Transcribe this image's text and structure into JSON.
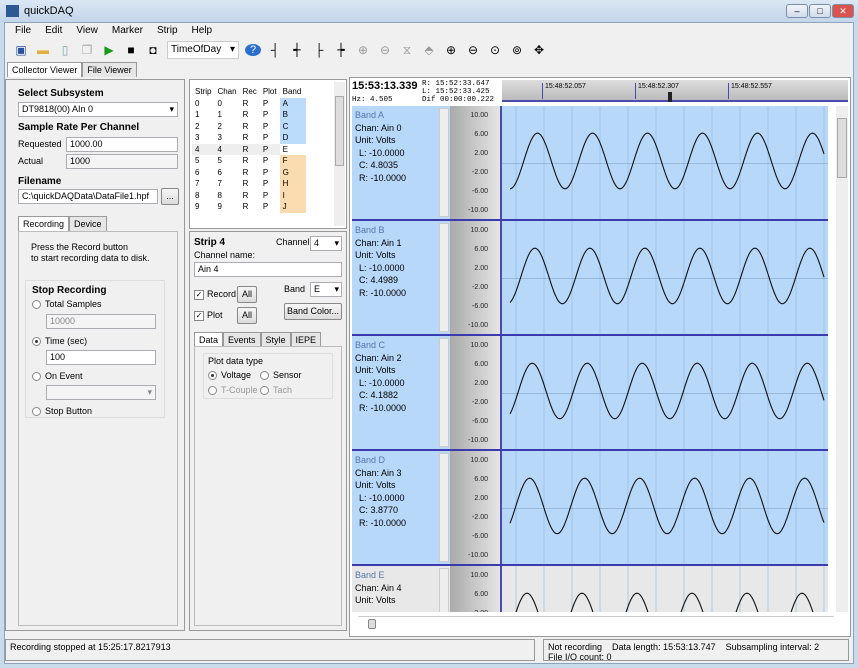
{
  "app": {
    "title": "quickDAQ",
    "minimize": "–",
    "maximize": "□",
    "close": "✕"
  },
  "menu": [
    "File",
    "Edit",
    "View",
    "Marker",
    "Strip",
    "Help"
  ],
  "toolbar": {
    "time_mode": "TimeOfDay"
  },
  "main_tabs": [
    "Collector Viewer",
    "File Viewer"
  ],
  "left": {
    "subsystem_label": "Select Subsystem",
    "subsystem": "DT9818(00) AIn 0",
    "rate_label": "Sample Rate Per Channel",
    "requested_label": "Requested",
    "requested": "1000.00",
    "actual_label": "Actual",
    "actual": "1000",
    "filename_label": "Filename",
    "filename": "C:\\quickDAQData\\DataFile1.hpf",
    "browse": "...",
    "tabs": [
      "Recording",
      "Device"
    ],
    "record_hint": "Press the Record button\nto start recording data to disk.",
    "stop_label": "Stop Recording",
    "total_samples": "Total Samples",
    "total_samples_value": "10000",
    "time_sec": "Time (sec)",
    "time_value": "100",
    "on_event": "On Event",
    "stop_button": "Stop Button",
    "selected": "time"
  },
  "strip_table": {
    "headers": [
      "Strip",
      "Chan",
      "Rec",
      "Plot",
      "Band"
    ],
    "rows": [
      [
        "0",
        "0",
        "R",
        "P",
        "A"
      ],
      [
        "1",
        "1",
        "R",
        "P",
        "B"
      ],
      [
        "2",
        "2",
        "R",
        "P",
        "C"
      ],
      [
        "3",
        "3",
        "R",
        "P",
        "D"
      ],
      [
        "4",
        "4",
        "R",
        "P",
        "E"
      ],
      [
        "5",
        "5",
        "R",
        "P",
        "F"
      ],
      [
        "6",
        "6",
        "R",
        "P",
        "G"
      ],
      [
        "7",
        "7",
        "R",
        "P",
        "H"
      ],
      [
        "8",
        "8",
        "R",
        "P",
        "I"
      ],
      [
        "9",
        "9",
        "R",
        "P",
        "J"
      ]
    ],
    "band_colors": {
      "A": "#bcdcfc",
      "B": "#bcdcfc",
      "C": "#bcdcfc",
      "D": "#bcdcfc",
      "E": "#ffffff",
      "F": "#fbdcb0",
      "G": "#fbdcb0",
      "H": "#fbdcb0",
      "I": "#fbdcb0",
      "J": "#fbdcb0"
    },
    "selected_row": 4
  },
  "strip_edit": {
    "title": "Strip 4",
    "channel_label": "Channel",
    "channel": "4",
    "name_label": "Channel name:",
    "name": "Ain 4",
    "record": "Record",
    "plot": "Plot",
    "all": "All",
    "band_label": "Band",
    "band": "E",
    "band_color": "Band Color...",
    "tabs": [
      "Data",
      "Events",
      "Style",
      "IEPE"
    ],
    "plot_type_label": "Plot data type",
    "voltage": "Voltage",
    "sensor": "Sensor",
    "tcouple": "T-Couple",
    "tach": "Tach"
  },
  "cursor": {
    "time": "15:53:13.339",
    "r_label": "R:",
    "r": "15:52:33.647",
    "l_label": "L:",
    "l": "15:52:33.425",
    "hz_label": "Hz:",
    "hz": "4.505",
    "dif_label": "Dif",
    "dif": "00:00:00.222",
    "ticks": [
      "15:48:52.057",
      "15:48:52.307",
      "15:48:52.557"
    ]
  },
  "y_ticks": [
    "10.00",
    "6.00",
    "2.00",
    "-2.00",
    "-6.00",
    "-10.00"
  ],
  "strips": [
    {
      "band": "Band A",
      "chan": "Chan: Ain 0",
      "unit": "Unit: Volts",
      "l": "L: -10.0000",
      "c": "C: 4.8035",
      "r": "R: -10.0000",
      "color": "#b8d8fa"
    },
    {
      "band": "Band B",
      "chan": "Chan: Ain 1",
      "unit": "Unit: Volts",
      "l": "L: -10.0000",
      "c": "C: 4.4989",
      "r": "R: -10.0000",
      "color": "#b8d8fa"
    },
    {
      "band": "Band C",
      "chan": "Chan: Ain 2",
      "unit": "Unit: Volts",
      "l": "L: -10.0000",
      "c": "C: 4.1882",
      "r": "R: -10.0000",
      "color": "#b8d8fa"
    },
    {
      "band": "Band D",
      "chan": "Chan: Ain 3",
      "unit": "Unit: Volts",
      "l": "L: -10.0000",
      "c": "C: 3.8770",
      "r": "R: -10.0000",
      "color": "#b8d8fa"
    },
    {
      "band": "Band E",
      "chan": "Chan: Ain 4",
      "unit": "Unit: Volts",
      "l": "",
      "c": "",
      "r": "",
      "color": "#e8e8e8"
    }
  ],
  "status": {
    "left": "Recording stopped at 15:25:17.8217913",
    "line1": "Not recording    Data length: 15:53:13.747    Subsampling interval: 2",
    "line2": "File I/O count: 0"
  }
}
